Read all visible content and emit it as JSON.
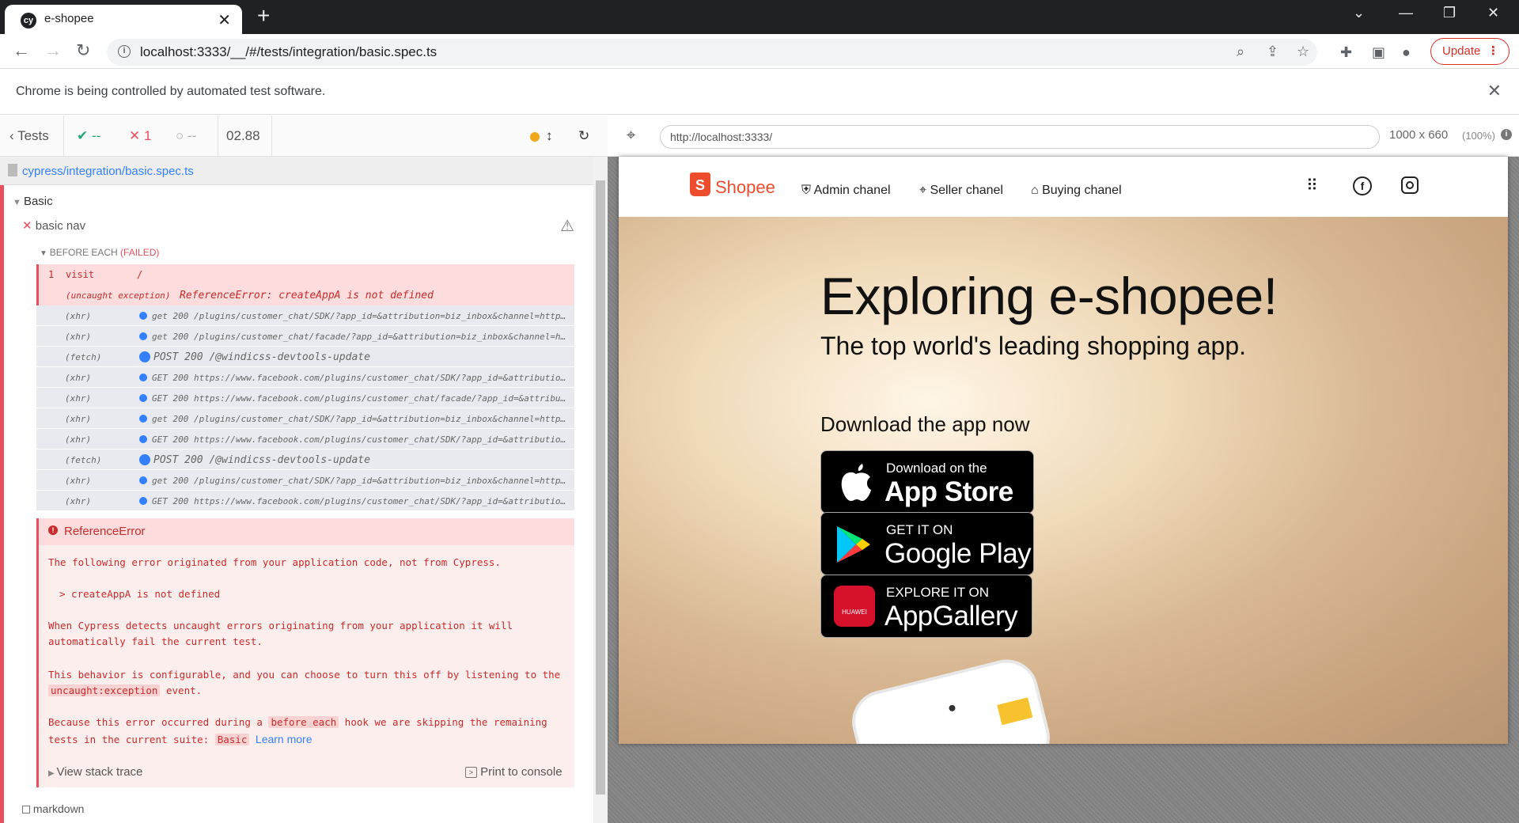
{
  "browser": {
    "tab_title": "e-shopee",
    "address": "localhost:3333/__/#/tests/integration/basic.spec.ts",
    "update_label": "Update",
    "infobar_message": "Chrome is being controlled by automated test software."
  },
  "reporter": {
    "tests_label": "Tests",
    "passed": "--",
    "failed": "1",
    "pending": "--",
    "duration": "02.88",
    "spec_path": "cypress/integration/basic.spec.ts",
    "suite_name": "Basic",
    "test_name": "basic nav",
    "hook_label": "BEFORE EACH",
    "hook_status": "(FAILED)",
    "visit_num": "1",
    "visit_cmd": "visit",
    "visit_arg": "/",
    "uncaught_type": "(uncaught exception)",
    "uncaught_msg": "ReferenceError: createAppA is not defined",
    "commands": [
      {
        "type": "(xhr)",
        "msg": "get 200 /plugins/customer_chat/SDK/?app_id=&attribution=biz_inbox&channel=https://…"
      },
      {
        "type": "(xhr)",
        "msg": "get 200 /plugins/customer_chat/facade/?app_id=&attribution=biz_inbox&channel=https…"
      },
      {
        "type": "(fetch)",
        "msg": "POST 200 /@windicss-devtools-update"
      },
      {
        "type": "(xhr)",
        "msg": "GET 200 https://www.facebook.com/plugins/customer_chat/SDK/?app_id=&attribution=bi…"
      },
      {
        "type": "(xhr)",
        "msg": "GET 200 https://www.facebook.com/plugins/customer_chat/facade/?app_id=&attribution…"
      },
      {
        "type": "(xhr)",
        "msg": "get 200 /plugins/customer_chat/SDK/?app_id=&attribution=biz_inbox&channel=https://…"
      },
      {
        "type": "(xhr)",
        "msg": "GET 200 https://www.facebook.com/plugins/customer_chat/SDK/?app_id=&attribution=bi…"
      },
      {
        "type": "(fetch)",
        "msg": "POST 200 /@windicss-devtools-update"
      },
      {
        "type": "(xhr)",
        "msg": "get 200 /plugins/customer_chat/SDK/?app_id=&attribution=biz_inbox&channel=https://…"
      },
      {
        "type": "(xhr)",
        "msg": "GET 200 https://www.facebook.com/plugins/customer_chat/SDK/?app_id=&attribution=bi…"
      }
    ],
    "error": {
      "title": "ReferenceError",
      "line1": "The following error originated from your application code, not from Cypress.",
      "line2": "> createAppA is not defined",
      "line3": "When Cypress detects uncaught errors originating from your application it will",
      "line4": "automatically fail the current test.",
      "line5": "This behavior is configurable, and you can choose to turn this off by listening to the",
      "line6_code": "uncaught:exception",
      "line6_rest": "event.",
      "line7_pre": "Because this error occurred during a",
      "line7_code": "before each",
      "line7_post": "hook we are skipping the remaining",
      "line8_pre": "tests in the current suite:",
      "line8_code": "Basic",
      "learn_more": "Learn more",
      "stack_trace": "View stack trace",
      "print_console": "Print to console"
    },
    "next_test": "markdown"
  },
  "aut": {
    "url": "http://localhost:3333/",
    "viewport": "1000 x 660",
    "zoom": "(100%)"
  },
  "shop": {
    "brand": "Shopee",
    "nav": [
      "Admin chanel",
      "Seller chanel",
      "Buying chanel"
    ],
    "hero_title": "Exploring e-shopee!",
    "hero_subtitle": "The top world's leading shopping app.",
    "download_label": "Download the app now",
    "appstore_small": "Download on the",
    "appstore_big": "App Store",
    "googleplay_small": "GET IT ON",
    "googleplay_big": "Google Play",
    "appgallery_small": "EXPLORE IT ON",
    "appgallery_big": "AppGallery",
    "huawei_label": "HUAWEI"
  },
  "colors": {
    "cypress_fail": "#e94f5f",
    "shopee_orange": "#ee4d2d",
    "chrome_dark": "#202124",
    "link_blue": "#3380ff"
  }
}
